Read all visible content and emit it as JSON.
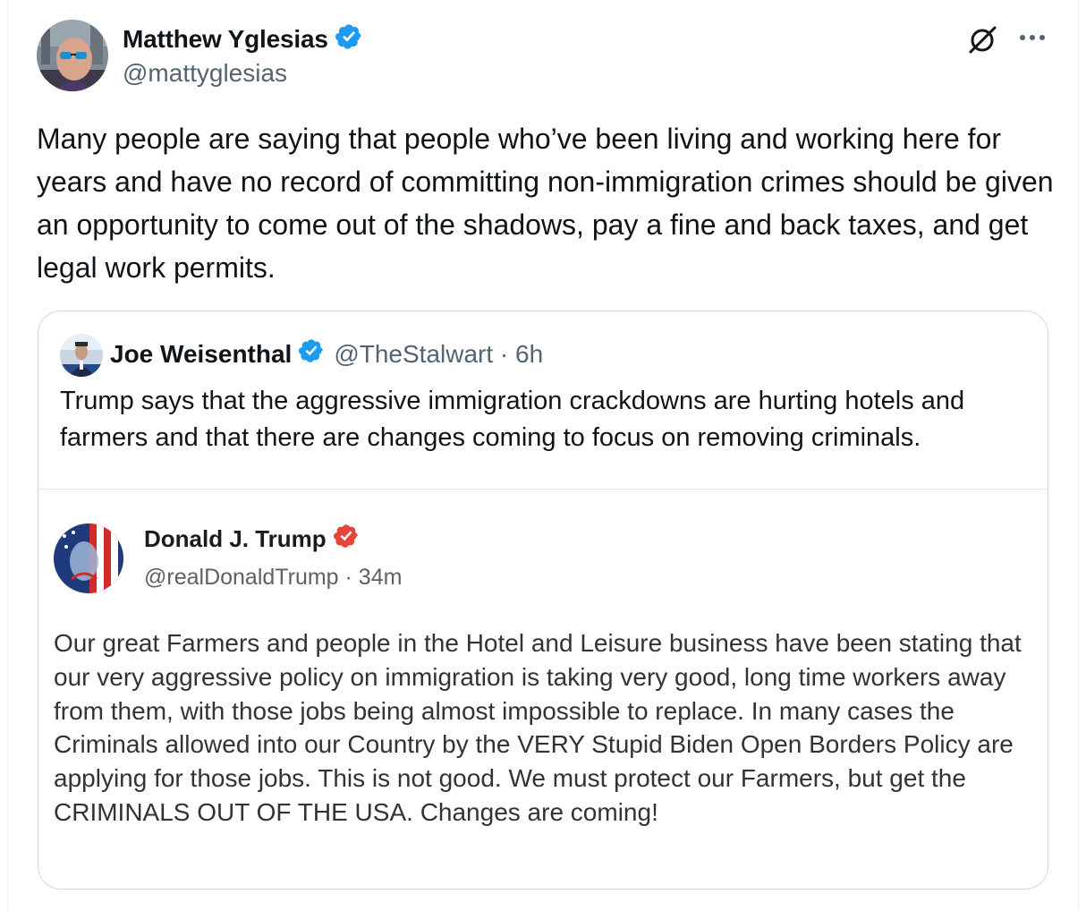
{
  "main": {
    "author_name": "Matthew Yglesias",
    "author_handle": "@mattyglesias",
    "tweet_text": "Many people are saying that people who’ve been living and working here for years and have no record of committing non-immigration crimes should be given an opportunity to come out of the shadows, pay a fine and back taxes, and get legal work permits.",
    "more_icon": "more-options-icon",
    "grok_icon": "grok-icon"
  },
  "quote": {
    "author_name": "Joe Weisenthal",
    "author_handle": "@TheStalwart · 6h",
    "text": "Trump says that the aggressive immigration crackdowns are hurting hotels and farmers and that there are changes coming to focus on removing criminals."
  },
  "embedded": {
    "author_name": "Donald J. Trump",
    "author_handle": "@realDonaldTrump · 34m",
    "text": "Our great Farmers and people in the Hotel and Leisure business have been stating that our very aggressive policy on immigration is taking very good, long time workers away from them, with those jobs being almost impossible to replace. In many cases the Criminals allowed into our Country by the VERY Stupid Biden Open Borders Policy are applying for those jobs. This is not good. We must protect our Farmers, but get the CRIMINALS OUT OF THE USA. Changes are coming!"
  },
  "colors": {
    "verified_blue": "#1d9bf0",
    "verified_red": "#e5453a",
    "secondary_text": "#536471"
  }
}
